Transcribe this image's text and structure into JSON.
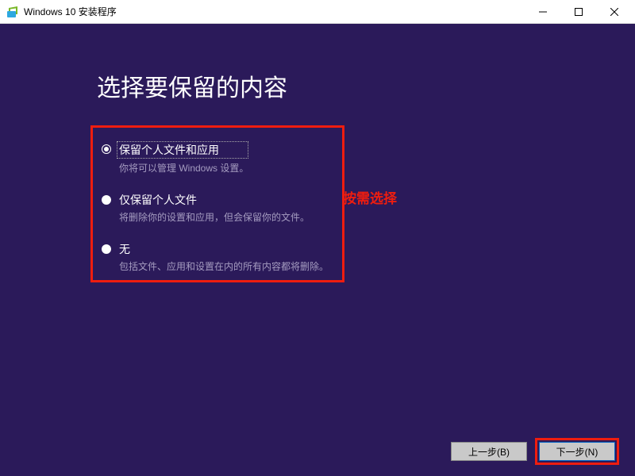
{
  "titlebar": {
    "title": "Windows 10 安装程序"
  },
  "heading": "选择要保留的内容",
  "options": [
    {
      "label": "保留个人文件和应用",
      "desc": "你将可以管理 Windows 设置。",
      "selected": true,
      "focused": true
    },
    {
      "label": "仅保留个人文件",
      "desc": "将删除你的设置和应用，但会保留你的文件。",
      "selected": false
    },
    {
      "label": "无",
      "desc": "包括文件、应用和设置在内的所有内容都将删除。",
      "selected": false
    }
  ],
  "annotation": "按需选择",
  "buttons": {
    "back": "上一步(B)",
    "next": "下一步(N)"
  },
  "colors": {
    "background": "#2b1a5a",
    "highlight": "#ef1d0f",
    "desc_text": "#a59cc0"
  }
}
